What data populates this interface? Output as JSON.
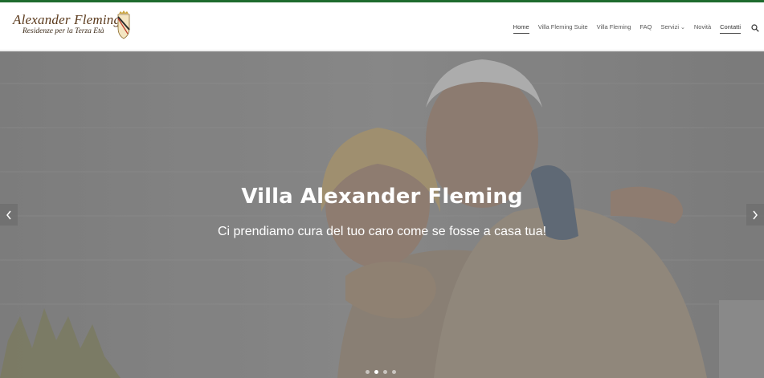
{
  "colors": {
    "accent": "#1e6b2e",
    "logo": "#5b3a1c"
  },
  "logo": {
    "name": "Alexander Fleming",
    "subtitle": "Residenze per la Terza Età"
  },
  "nav": {
    "items": [
      {
        "label": "Home",
        "active": true
      },
      {
        "label": "Villa Fleming Suite"
      },
      {
        "label": "Villa Fleming"
      },
      {
        "label": "FAQ"
      },
      {
        "label": "Servizi",
        "dropdown": true
      },
      {
        "label": "Novità"
      },
      {
        "label": "Contatti",
        "active": true
      }
    ],
    "search_icon": "search-icon"
  },
  "hero": {
    "title": "Villa Alexander Fleming",
    "subtitle": "Ci prendiamo cura del tuo caro come se fosse a casa tua!",
    "prev_icon": "chevron-left-icon",
    "next_icon": "chevron-right-icon",
    "slides_count": 4,
    "active_slide": 2
  }
}
